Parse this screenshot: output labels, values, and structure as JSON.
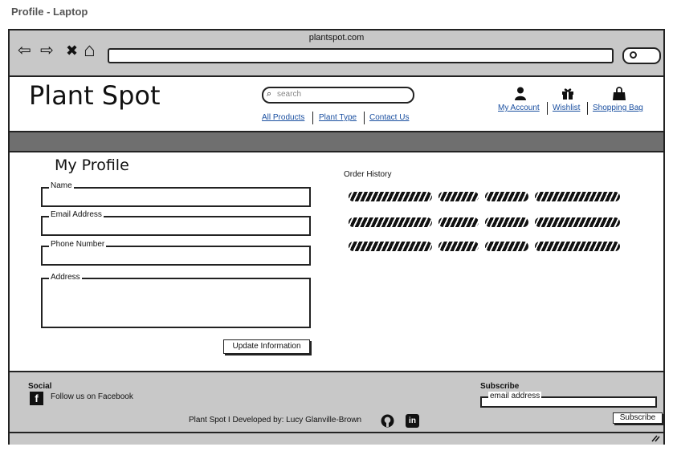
{
  "page_label": "Profile - Laptop",
  "browser": {
    "url": "plantspot.com",
    "back_glyph": "⇦",
    "forward_glyph": "⇨",
    "close_glyph": "✖",
    "home_glyph": "⌂"
  },
  "header": {
    "logo": "Plant Spot",
    "search_placeholder": "search",
    "search_glyph": "⌕",
    "nav": [
      "All Products",
      "Plant Type",
      "Contact Us"
    ],
    "account_links": [
      "My Account",
      "Wishlist",
      "Shopping Bag"
    ],
    "icons": {
      "account": "user-icon",
      "wishlist": "gift-icon",
      "bag": "shopping-bag-icon"
    }
  },
  "profile": {
    "title": "My Profile",
    "fields": {
      "name": "Name",
      "email": "Email Address",
      "phone": "Phone Number",
      "address": "Address"
    },
    "update_button": "Update Information"
  },
  "orders": {
    "title": "Order History"
  },
  "footer": {
    "social_title": "Social",
    "facebook_glyph": "f",
    "facebook_text": "Follow us on Facebook",
    "subscribe_title": "Subscribe",
    "email_placeholder": "email address",
    "subscribe_button": "Subscribe",
    "credit": "Plant Spot I Developed by: Lucy Glanville-Brown",
    "linkedin_glyph": "in"
  }
}
